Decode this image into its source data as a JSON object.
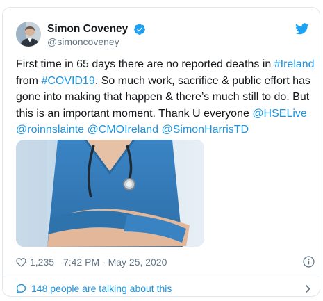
{
  "author": {
    "name": "Simon Coveney",
    "handle": "@simoncoveney",
    "verified": true
  },
  "tweet": {
    "segments": [
      {
        "text": "First time in 65 days there are no reported deaths in ",
        "type": "text"
      },
      {
        "text": "#Ireland",
        "type": "link"
      },
      {
        "text": " from ",
        "type": "text"
      },
      {
        "text": "#COVID19",
        "type": "link"
      },
      {
        "text": ". So much work, sacrifice & public effort has gone into making that happen & there’s much still to do. But this is an important moment. Thank U everyone ",
        "type": "text"
      },
      {
        "text": "@HSELive",
        "type": "link"
      },
      {
        "text": " ",
        "type": "text"
      },
      {
        "text": "@roinnslainte",
        "type": "link"
      },
      {
        "text": " ",
        "type": "text"
      },
      {
        "text": "@CMOIreland",
        "type": "link"
      },
      {
        "text": " ",
        "type": "text"
      },
      {
        "text": "@SimonHarrisTD",
        "type": "link"
      }
    ]
  },
  "meta": {
    "likes": "1,235",
    "timestamp": "7:42 PM - May 25, 2020"
  },
  "footer": {
    "talking": "148 people are talking about this"
  },
  "icons": {
    "heart": "heart-icon",
    "info": "info-icon",
    "bird": "twitter-bird-icon",
    "verified": "verified-badge-icon",
    "comment": "speech-bubble-icon",
    "chevron": "chevron-right-icon"
  },
  "colors": {
    "link": "#1b95e0",
    "muted": "#657786",
    "text": "#14171a",
    "border": "#e1e8ed",
    "verified": "#1da1f2",
    "scrubs": "#3f86c6"
  }
}
